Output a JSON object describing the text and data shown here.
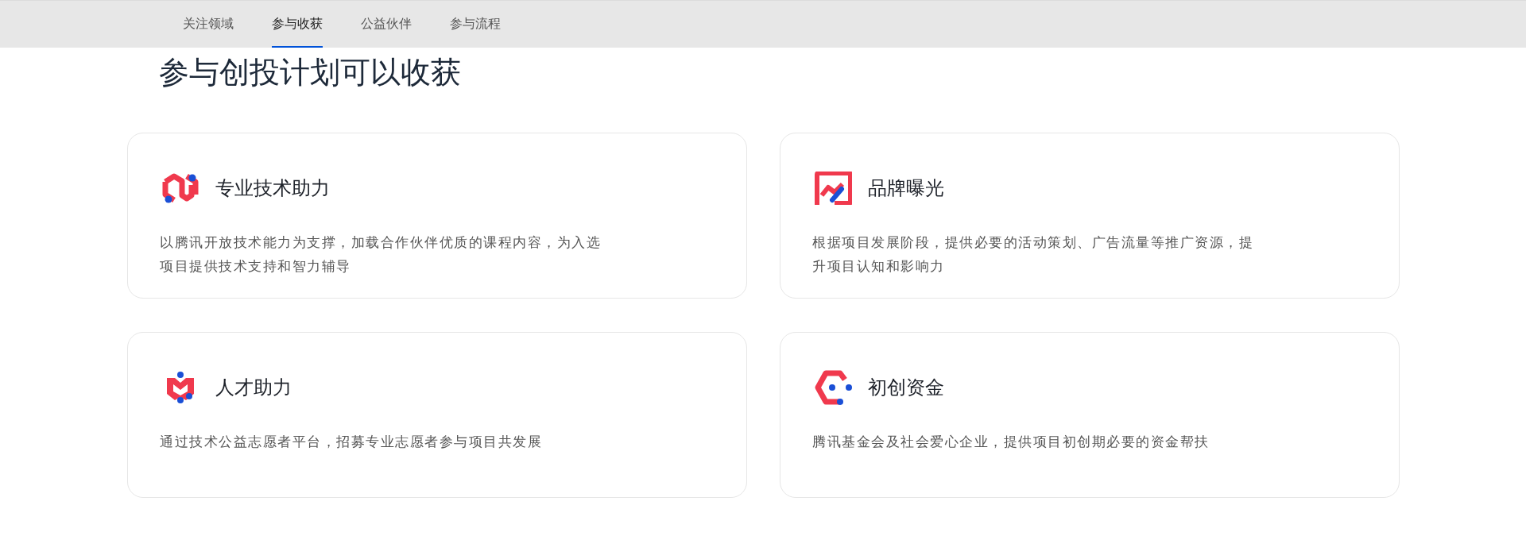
{
  "nav": {
    "tabs": [
      {
        "label": "关注领域",
        "selected": false
      },
      {
        "label": "参与收获",
        "selected": true
      },
      {
        "label": "公益伙伴",
        "selected": false
      },
      {
        "label": "参与流程",
        "selected": false
      }
    ]
  },
  "section": {
    "title": "参与创投计划可以收获",
    "cards": [
      {
        "kind": "tech",
        "heading": "专业技术助力",
        "description": [
          "以腾讯开放技术能力为支撑，加载合作伙伴优质的课程内容，为入选",
          "项目提供技术支持和智力辅导"
        ]
      },
      {
        "kind": "brand",
        "heading": "品牌曝光",
        "description": [
          "根据项目发展阶段，提供必要的活动策划、广告流量等推广资源，提",
          "升项目认知和影响力"
        ]
      },
      {
        "kind": "talent",
        "heading": "人才助力",
        "description": [
          "通过技术公益志愿者平台，招募专业志愿者参与项目共发展"
        ]
      },
      {
        "kind": "fund",
        "heading": "初创资金",
        "description": [
          "腾讯基金会及社会爱心企业，提供项目初创期必要的资金帮扶"
        ]
      }
    ]
  }
}
